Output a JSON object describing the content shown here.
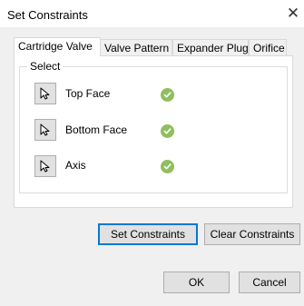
{
  "window": {
    "title": "Set Constraints",
    "close_glyph": "✕"
  },
  "tabs": [
    {
      "label": "Cartridge Valve",
      "active": true
    },
    {
      "label": "Valve Pattern",
      "active": false
    },
    {
      "label": "Expander Plug",
      "active": false
    },
    {
      "label": "Orifice",
      "active": false
    }
  ],
  "select_group": {
    "label": "Select",
    "items": [
      {
        "label": "Top Face",
        "icon": "cursor-icon",
        "status": "check-icon"
      },
      {
        "label": "Bottom Face",
        "icon": "cursor-icon",
        "status": "check-icon"
      },
      {
        "label": "Axis",
        "icon": "cursor-icon",
        "status": "check-icon"
      }
    ]
  },
  "buttons": {
    "set_constraints": "Set Constraints",
    "clear_constraints": "Clear Constraints",
    "ok": "OK",
    "cancel": "Cancel"
  },
  "colors": {
    "check": "#8fbf5e",
    "default_button_border": "#0078d7"
  }
}
